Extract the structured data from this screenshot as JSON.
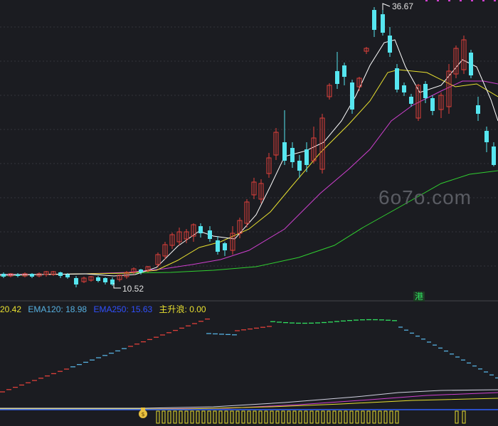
{
  "markers": {
    "high_price": "36.67",
    "low_price": "10.52",
    "badge": "港",
    "watermark": "6o7o.com"
  },
  "legend": {
    "item1": "20.42",
    "item2": "EMA120: 18.98",
    "item3": "EMA250: 15.63",
    "item4": "主升浪: 0.00"
  },
  "colors": {
    "background": "#1b1c21",
    "up_candle": "#e0403a",
    "down_candle": "#56e6f0",
    "ema_fast": "#ffffff",
    "ema_mid": "#e8e030",
    "ema_slow": "#d040d0",
    "ema_long": "#30d030",
    "legend1": "#e8e030",
    "legend2": "#56b0e0",
    "legend3": "#3050ff",
    "legend4": "#e8e030",
    "baseline": "#3060ff",
    "bars": "#e8e030"
  }
}
